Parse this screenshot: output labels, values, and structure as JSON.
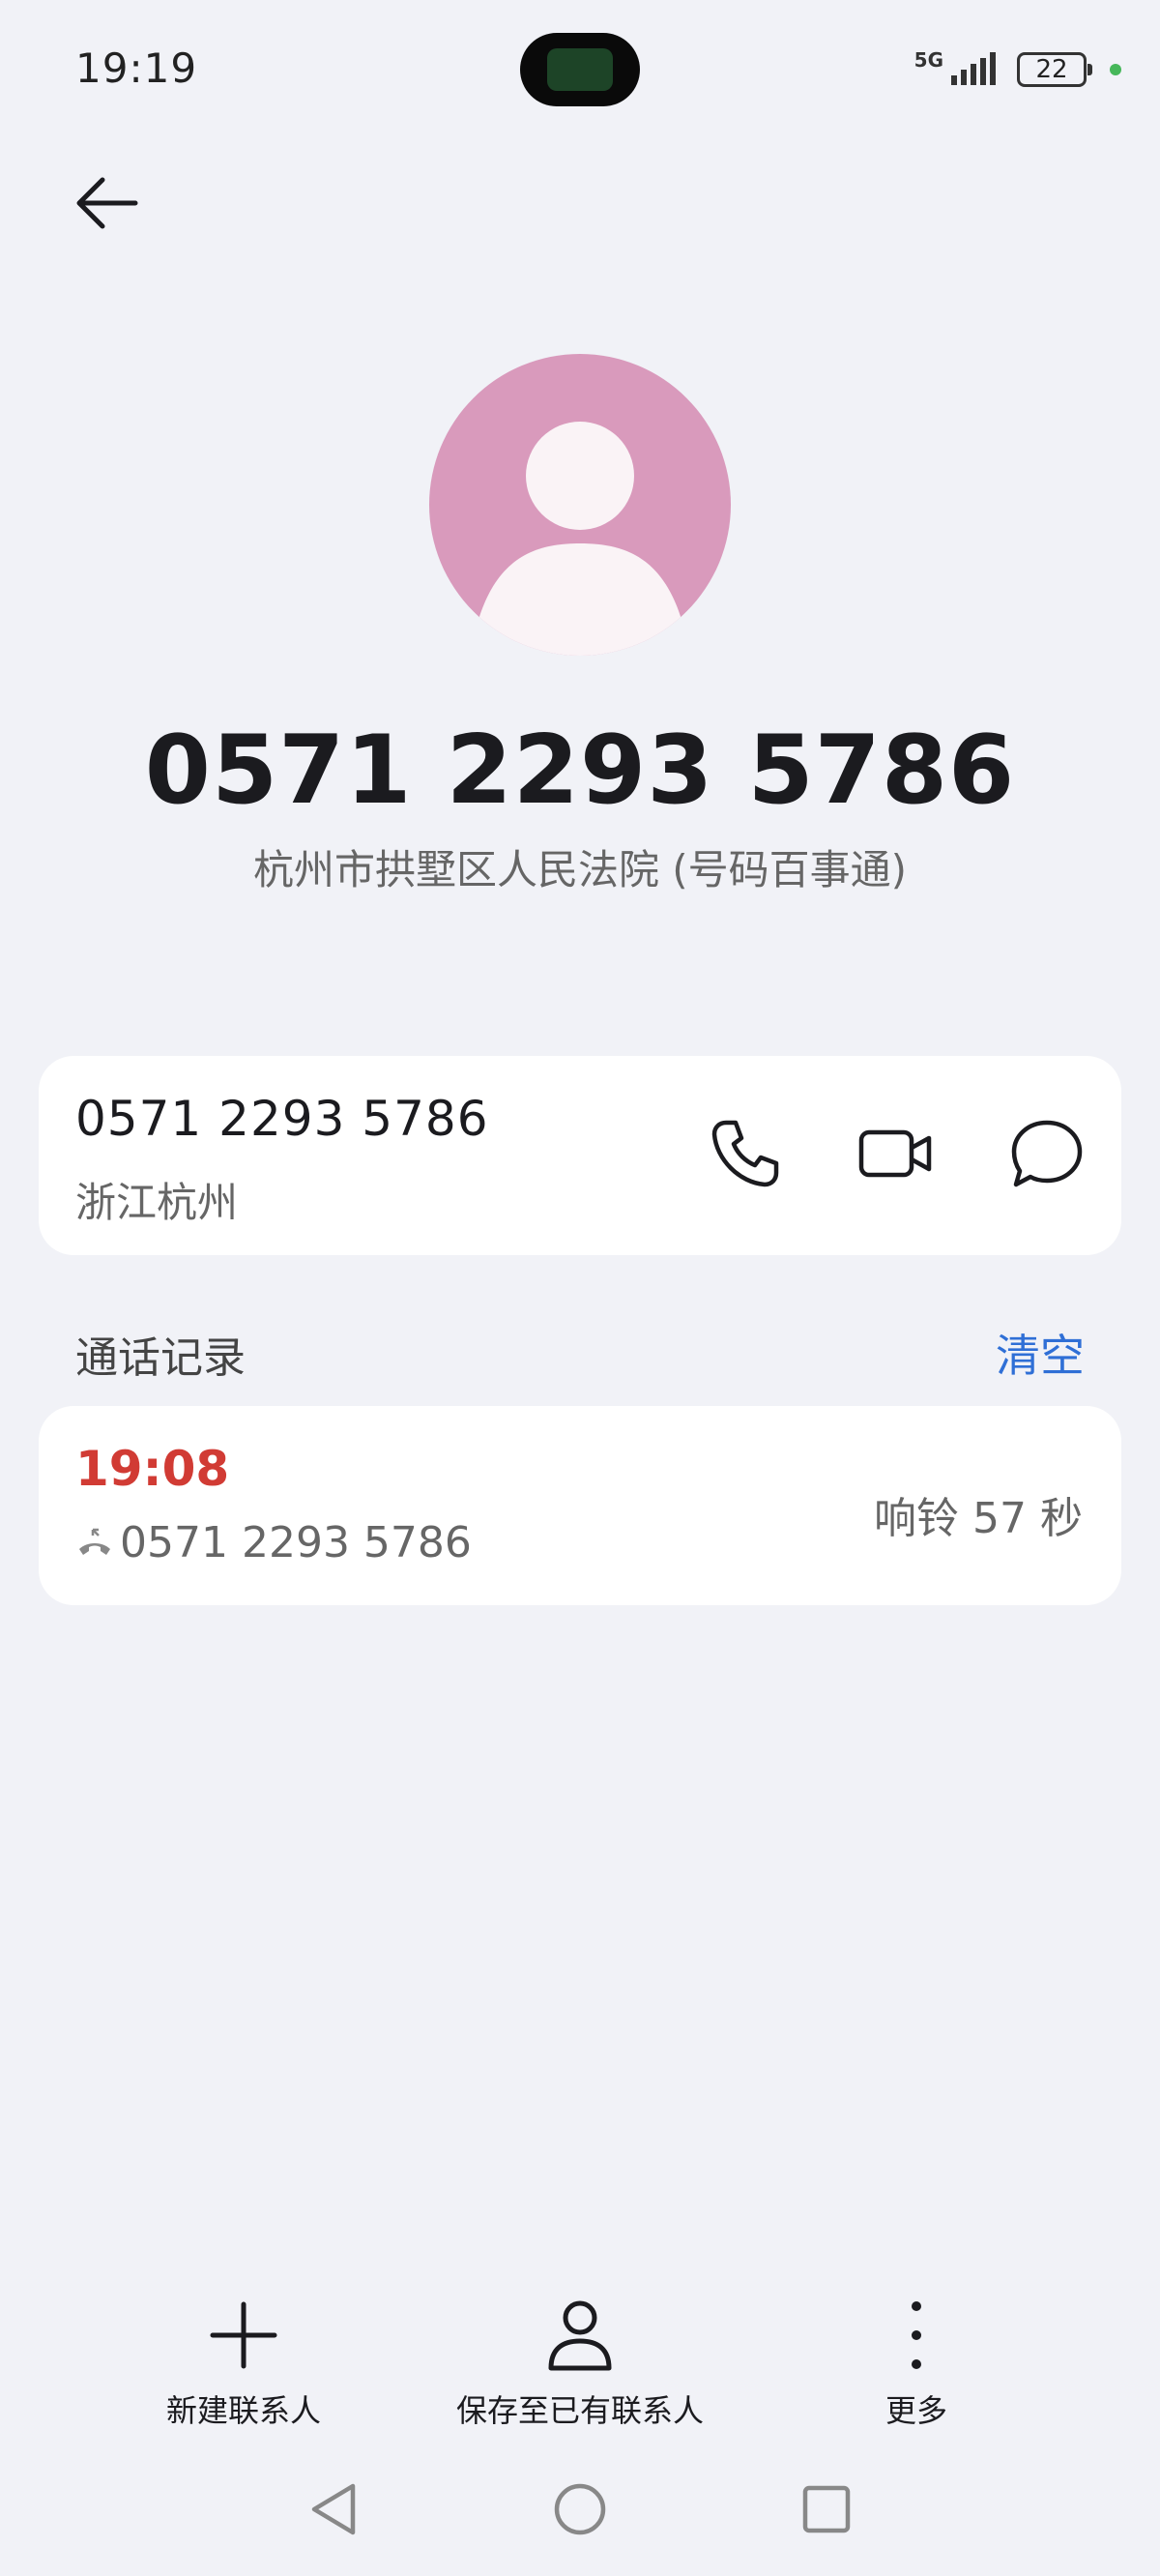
{
  "status": {
    "time": "19:19",
    "network": "5G",
    "battery": "22",
    "colors": {
      "dot": "#46b75a"
    }
  },
  "contact": {
    "number": "0571 2293 5786",
    "label": "杭州市拱墅区人民法院 (号码百事通)",
    "avatar_color": "#d99abc"
  },
  "number_card": {
    "number": "0571 2293 5786",
    "location": "浙江杭州",
    "actions": [
      "phone-icon",
      "video-call-icon",
      "message-icon"
    ]
  },
  "call_log": {
    "title": "通话记录",
    "clear_label": "清空",
    "entries": [
      {
        "time": "19:08",
        "number": "0571 2293 5786",
        "duration": "响铃 57 秒",
        "status_color": "#d13b34"
      }
    ]
  },
  "bottom_actions": {
    "new_contact": "新建联系人",
    "save_to_existing": "保存至已有联系人",
    "more": "更多"
  },
  "colors": {
    "accent": "#2f6fd6",
    "background": "#f1f2f7",
    "missed": "#d13b34"
  }
}
